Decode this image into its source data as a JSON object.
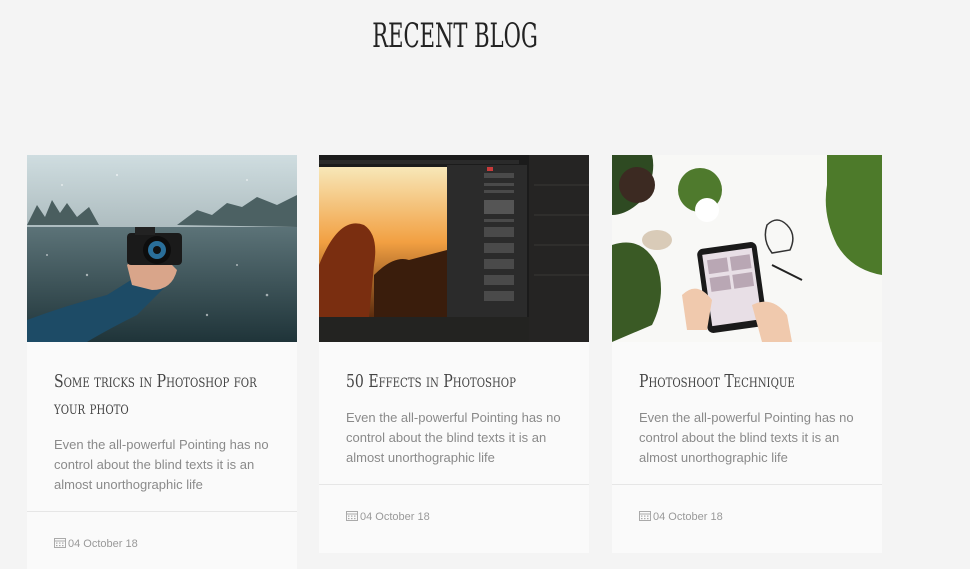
{
  "section": {
    "title": "RECENT BLOG"
  },
  "posts": [
    {
      "title": "Some tricks in Photoshop for your photo",
      "excerpt": "Even the all-powerful Pointing has no control about the blind texts it is an almost unorthographic life",
      "date": "04 October 18",
      "image_icon": "camera-lake-photo"
    },
    {
      "title": "50 Effects in Photoshop",
      "excerpt": "Even the all-powerful Pointing has no control about the blind texts it is an almost unorthographic life",
      "date": "04 October 18",
      "image_icon": "photoshop-monitor-photo"
    },
    {
      "title": "Photoshoot Technique",
      "excerpt": "Even the all-powerful Pointing has no control about the blind texts it is an almost unorthographic life",
      "date": "04 October 18",
      "image_icon": "tablet-plants-photo"
    }
  ],
  "icons": {
    "date": "calendar-icon"
  },
  "colors": {
    "background": "#f4f4f4",
    "card": "#fafafa",
    "title": "#444444",
    "text": "#8a8a8a"
  }
}
